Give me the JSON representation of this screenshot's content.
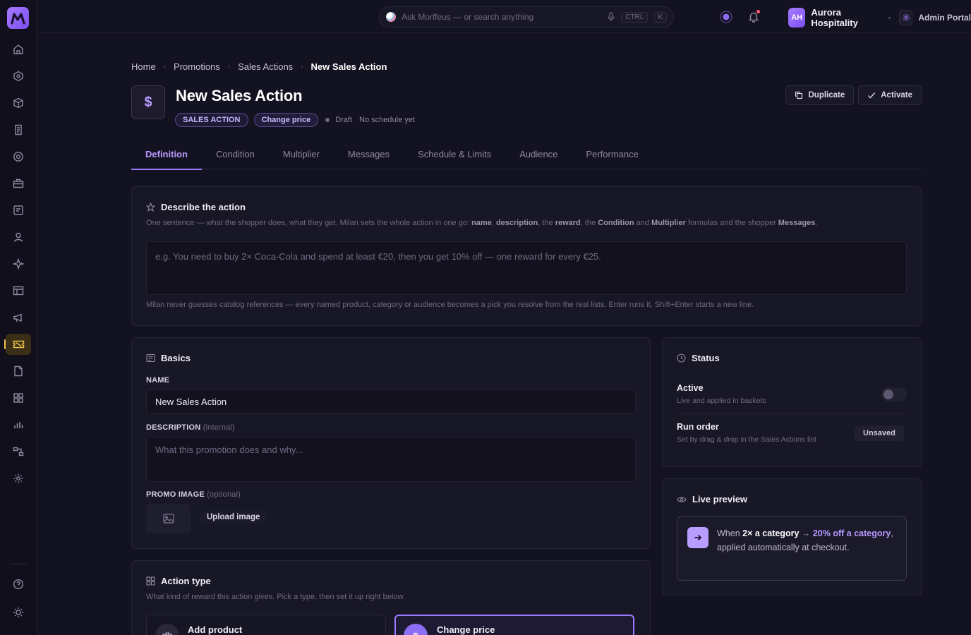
{
  "app": {
    "logo_letter": "M"
  },
  "topbar": {
    "search_placeholder": "Ask Morffeus — or search anything",
    "kbd_ctrl": "CTRL",
    "kbd_k": "K",
    "org_initials": "AH",
    "org_name": "Aurora Hospitality",
    "portal_name": "Admin Portal"
  },
  "sidebar": {
    "items": [
      {
        "icon": "home-icon"
      },
      {
        "icon": "hexagon-icon"
      },
      {
        "icon": "box-icon"
      },
      {
        "icon": "receipt-icon"
      },
      {
        "icon": "globe-icon"
      },
      {
        "icon": "briefcase-icon"
      },
      {
        "icon": "document-list-icon"
      },
      {
        "icon": "user-icon"
      },
      {
        "icon": "sparkle-icon"
      },
      {
        "icon": "table-icon"
      },
      {
        "icon": "megaphone-icon"
      },
      {
        "icon": "ticket-icon",
        "active": true
      },
      {
        "icon": "file-icon"
      },
      {
        "icon": "grid-icon"
      },
      {
        "icon": "bar-chart-icon"
      },
      {
        "icon": "flow-icon"
      },
      {
        "icon": "settings-icon"
      }
    ],
    "bottom": [
      {
        "icon": "help-icon"
      },
      {
        "icon": "sun-icon"
      }
    ]
  },
  "breadcrumb": [
    "Home",
    "Promotions",
    "Sales Actions",
    "New Sales Action"
  ],
  "header": {
    "icon_glyph": "$",
    "title": "New Sales Action",
    "type_pill": "SALES ACTION",
    "kind_pill": "Change price",
    "status": "Draft",
    "schedule": "No schedule yet",
    "duplicate_label": "Duplicate",
    "activate_label": "Activate"
  },
  "tabs": [
    "Definition",
    "Condition",
    "Multiplier",
    "Messages",
    "Schedule & Limits",
    "Audience",
    "Performance"
  ],
  "describe": {
    "title": "Describe the action",
    "help_prefix": "One sentence — what the shopper does, what they get. Milan sets the whole action in one go: ",
    "help_name": "name",
    "help_description": "description",
    "help_the": ", the ",
    "help_reward": "reward",
    "help_the2": ", the ",
    "help_condition": "Condition",
    "help_and": " and ",
    "help_multiplier": "Multiplier",
    "help_formulas": " formulas and the shopper ",
    "help_messages": "Messages",
    "help_end": ".",
    "placeholder": "e.g. You need to buy 2× Coca-Cola and spend at least €20, then you get 10% off — one reward for every €25.",
    "footer": "Milan never guesses catalog references — every named product, category or audience becomes a pick you resolve from the real lists. Enter runs it, Shift+Enter starts a new line."
  },
  "basics": {
    "title": "Basics",
    "name_label": "NAME",
    "name_value": "New Sales Action",
    "description_label": "DESCRIPTION",
    "description_note": "(internal)",
    "description_placeholder": "What this promotion does and why...",
    "image_label": "PROMO IMAGE",
    "image_note": "(optional)",
    "upload_label": "Upload image"
  },
  "status_card": {
    "title": "Status",
    "active_label": "Active",
    "active_sub": "Live and applied in baskets",
    "active_on": false,
    "run_order_label": "Run order",
    "run_order_sub": "Set by drag & drop in the Sales Actions list",
    "run_order_badge": "Unsaved"
  },
  "live_preview": {
    "title": "Live preview",
    "when": "When ",
    "condition": "2× a category",
    "arrow": " → ",
    "reward": "20% off a category",
    "suffix": ", applied automatically at checkout."
  },
  "action_type": {
    "title": "Action type",
    "help": "What kind of reward this action gives. Pick a type, then set it up right below.",
    "options": [
      {
        "label": "Add product",
        "selected": false
      },
      {
        "label": "Change price",
        "selected": true
      }
    ]
  }
}
